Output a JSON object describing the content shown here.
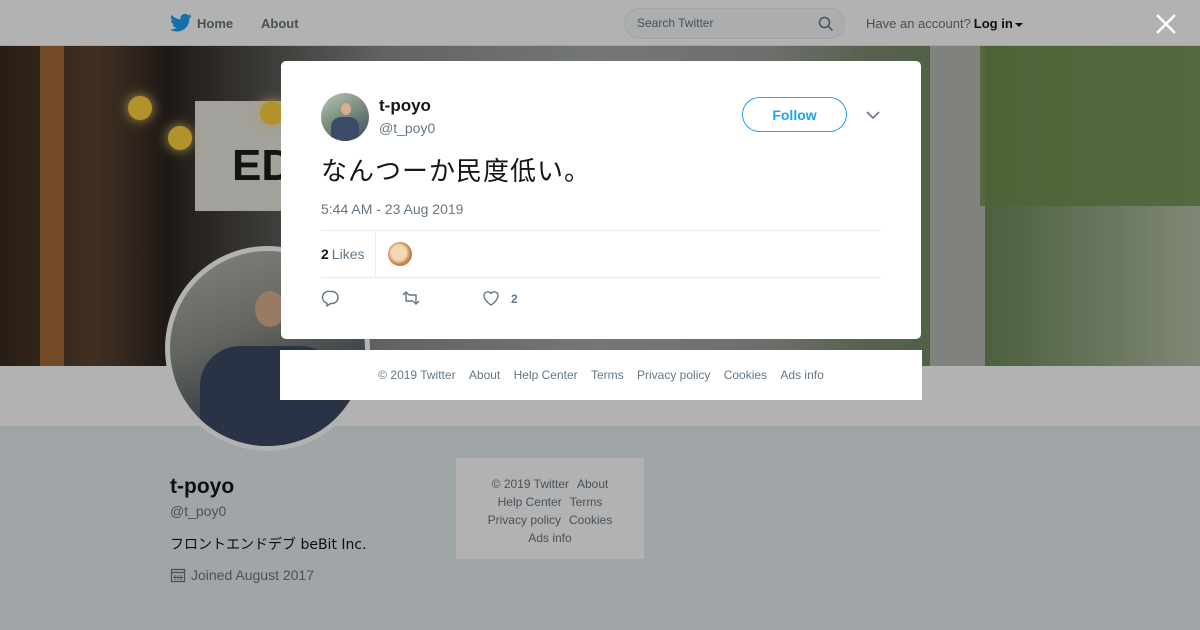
{
  "nav": {
    "home": "Home",
    "about": "About",
    "search_placeholder": "Search Twitter",
    "account_prompt": "Have an account?",
    "login": "Log in"
  },
  "profile": {
    "name": "t-poyo",
    "handle": "@t_poy0",
    "bio": "フロントエンドデブ beBit Inc.",
    "joined": "Joined August 2017"
  },
  "side_footer": {
    "items": [
      "© 2019 Twitter",
      "About",
      "Help Center",
      "Terms",
      "Privacy policy",
      "Cookies",
      "Ads info"
    ]
  },
  "tweet": {
    "name": "t-poyo",
    "handle": "@t_poy0",
    "follow_label": "Follow",
    "text": "なんつーか民度低い。",
    "timestamp": "5:44 AM - 23 Aug 2019",
    "likes_count": "2",
    "likes_label": "Likes",
    "like_action_count": "2"
  },
  "modal_footer": {
    "items": [
      "© 2019 Twitter",
      "About",
      "Help Center",
      "Terms",
      "Privacy policy",
      "Cookies",
      "Ads info"
    ]
  },
  "colors": {
    "accent": "#1da1f2",
    "text_secondary": "#657786",
    "background": "#e6ecf0"
  },
  "icons": [
    "twitter-bird-icon",
    "search-icon",
    "caret-down-icon",
    "calendar-icon",
    "close-icon",
    "chevron-down-icon",
    "reply-icon",
    "retweet-icon",
    "heart-icon"
  ]
}
